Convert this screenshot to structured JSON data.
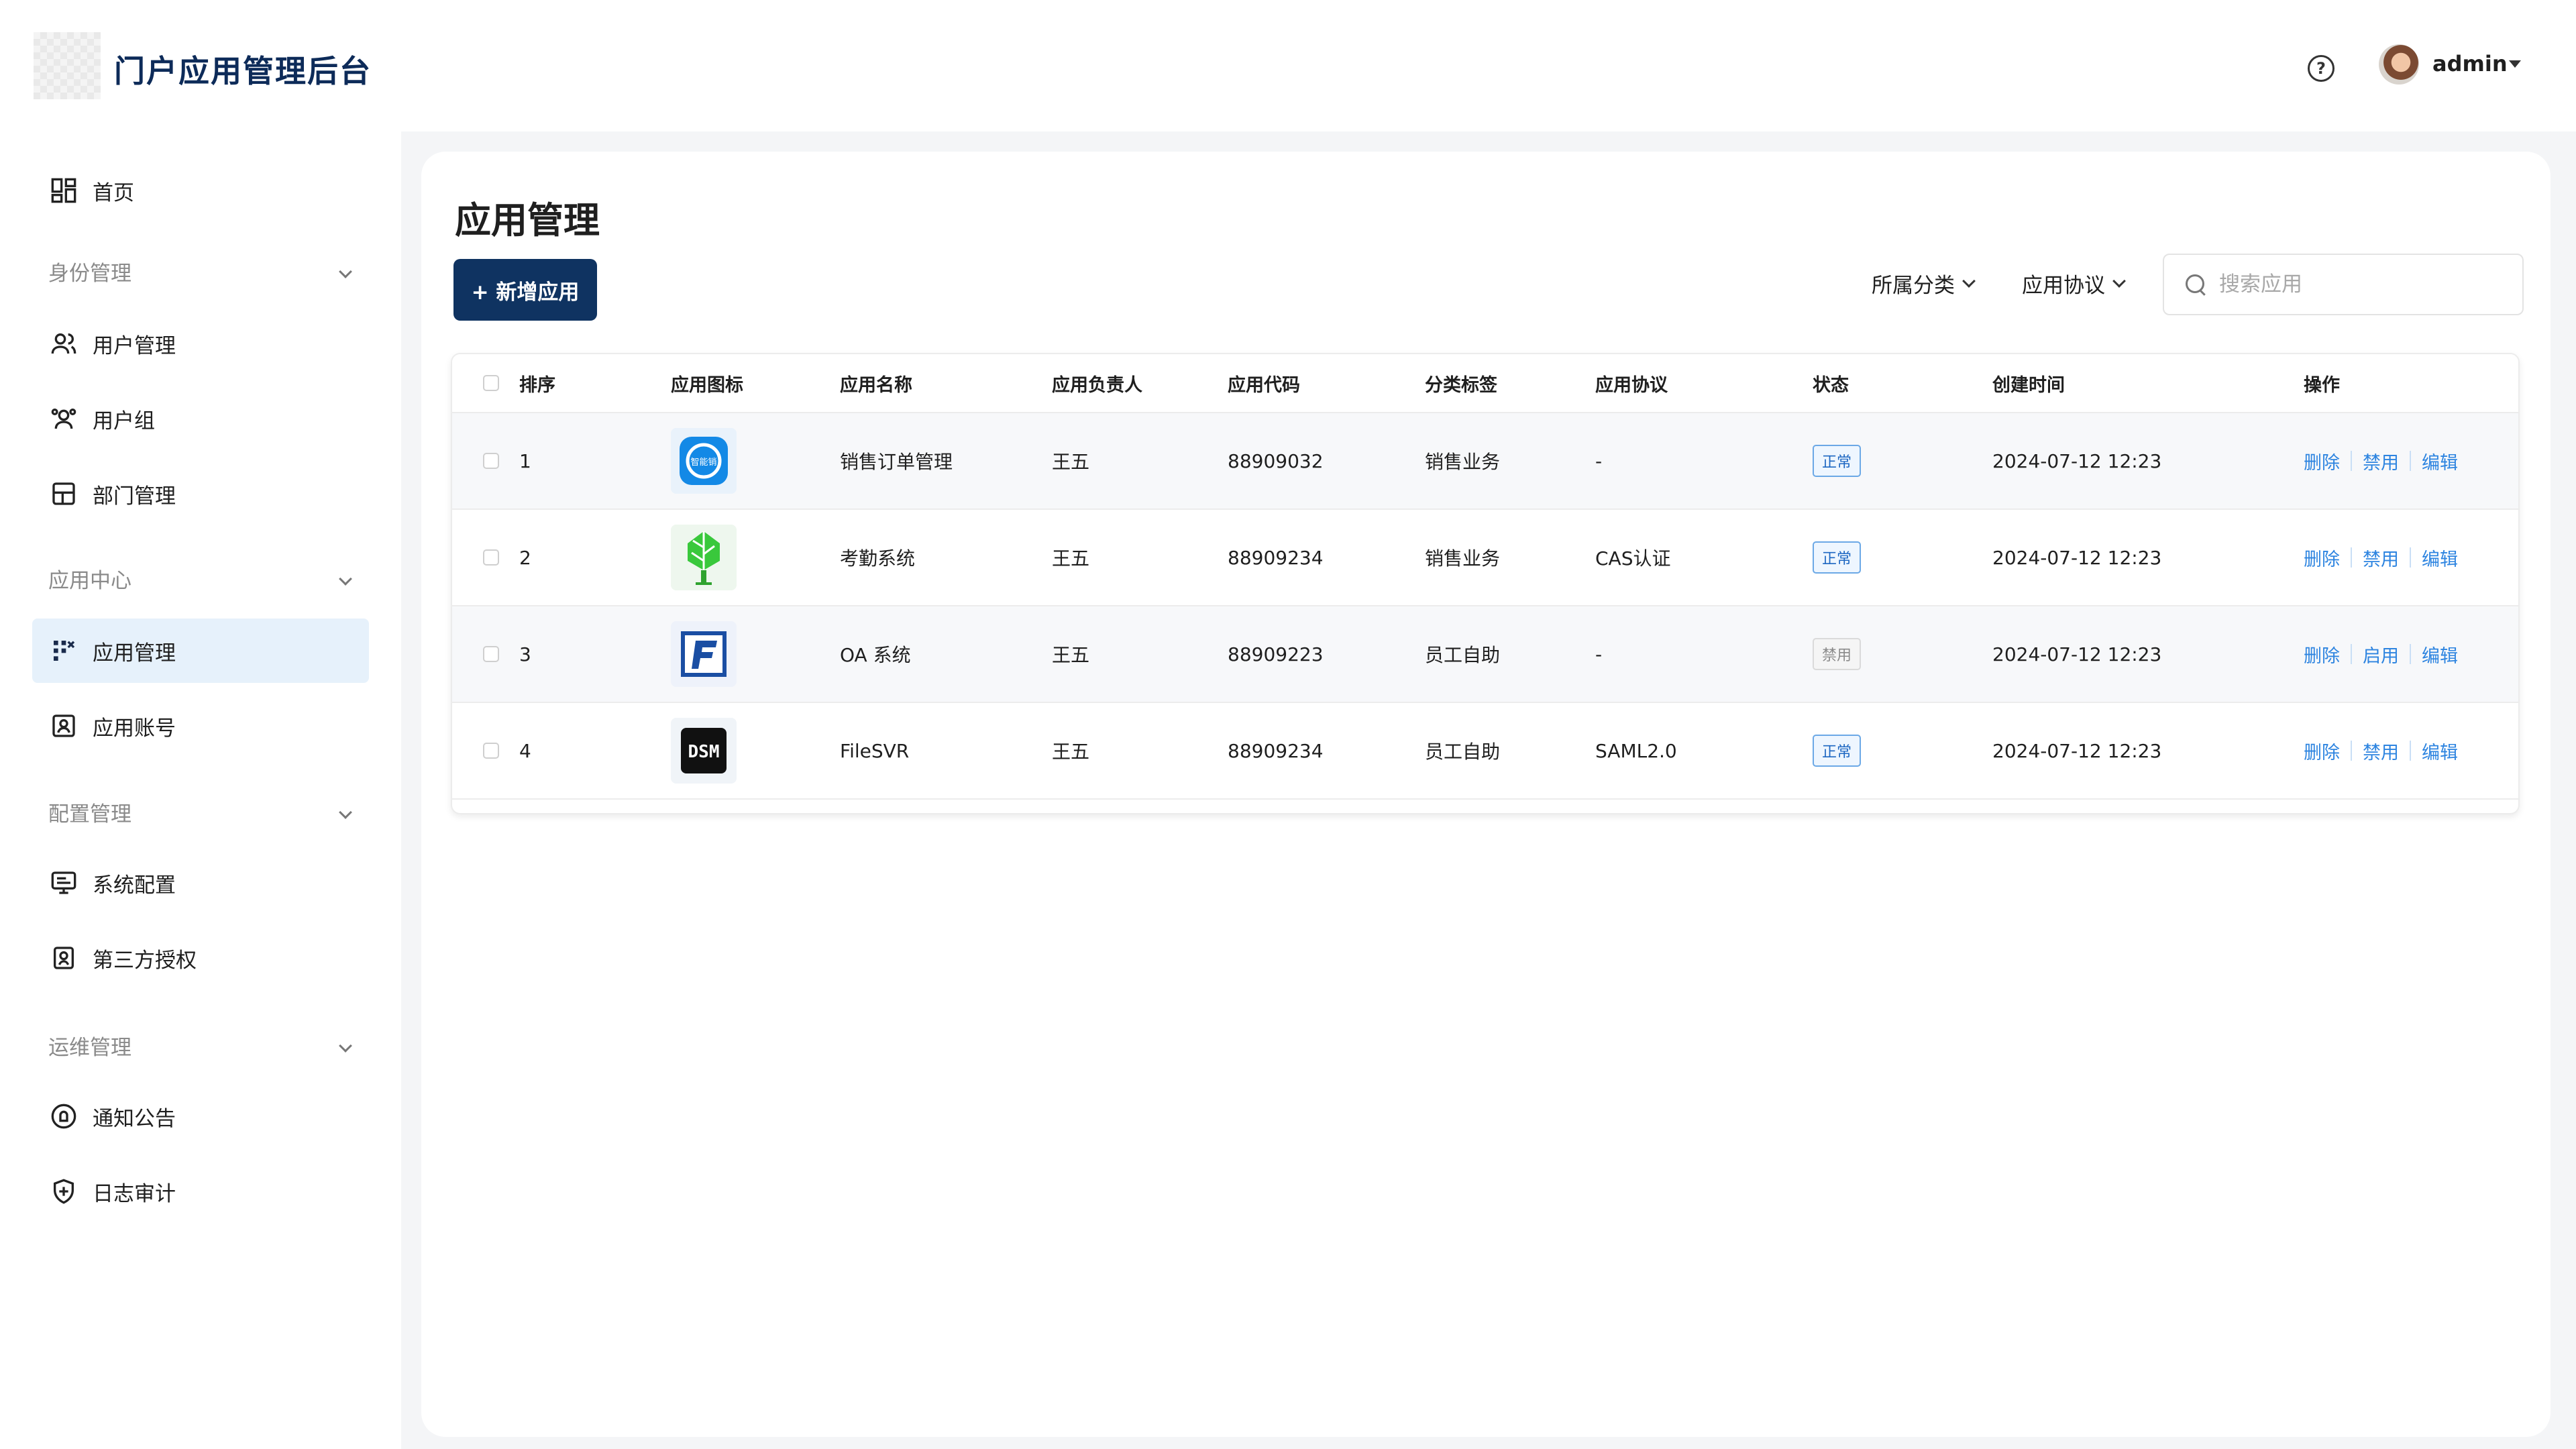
{
  "header": {
    "app_title": "门户应用管理后台",
    "help_icon": "question-circle-icon",
    "user_name": "admin"
  },
  "sidebar": {
    "home": "首页",
    "groups": {
      "identity": "身份管理",
      "app_center": "应用中心",
      "config": "配置管理",
      "ops": "运维管理"
    },
    "items": {
      "user_mgmt": "用户管理",
      "user_group": "用户组",
      "dept_mgmt": "部门管理",
      "app_mgmt": "应用管理",
      "app_account": "应用账号",
      "sys_config": "系统配置",
      "third_party": "第三方授权",
      "notice": "通知公告",
      "log_audit": "日志审计"
    },
    "active": "app_mgmt"
  },
  "main": {
    "title": "应用管理",
    "add_button": "+ 新增应用",
    "filters": {
      "category": "所属分类",
      "protocol": "应用协议"
    },
    "search": {
      "placeholder": "搜索应用",
      "value": ""
    }
  },
  "table": {
    "columns": {
      "order": "排序",
      "icon": "应用图标",
      "name": "应用名称",
      "owner": "应用负责人",
      "code": "应用代码",
      "tag": "分类标签",
      "protocol": "应用协议",
      "status": "状态",
      "created": "创建时间",
      "ops": "操作"
    },
    "rows": [
      {
        "order": "1",
        "icon": "blue-circle-logo",
        "name": "销售订单管理",
        "owner": "王五",
        "code": "88909032",
        "tag": "销售业务",
        "protocol": "-",
        "status": "正常",
        "created": "2024-07-12 12:23",
        "op1": "删除",
        "op2": "禁用",
        "op3": "编辑"
      },
      {
        "order": "2",
        "icon": "green-tree-logo",
        "name": "考勤系统",
        "owner": "王五",
        "code": "88909234",
        "tag": "销售业务",
        "protocol": "CAS认证",
        "status": "正常",
        "created": "2024-07-12 12:23",
        "op1": "删除",
        "op2": "禁用",
        "op3": "编辑"
      },
      {
        "order": "3",
        "icon": "blue-f-logo",
        "name": "OA 系统",
        "owner": "王五",
        "code": "88909223",
        "tag": "员工自助",
        "protocol": "-",
        "status": "禁用",
        "created": "2024-07-12 12:23",
        "op1": "删除",
        "op2": "启用",
        "op3": "编辑"
      },
      {
        "order": "4",
        "icon": "dsm-logo",
        "name": "FileSVR",
        "owner": "王五",
        "code": "88909234",
        "tag": "员工自助",
        "protocol": "SAML2.0",
        "status": "正常",
        "created": "2024-07-12 12:23",
        "op1": "删除",
        "op2": "禁用",
        "op3": "编辑"
      }
    ],
    "icon_texts": {
      "row1": "智能销",
      "row4": "DSM"
    }
  },
  "colors": {
    "brand": "#0f3361",
    "link": "#2d84e0",
    "active_bg": "#e6f1fb",
    "main_bg": "#f4f5f7"
  }
}
